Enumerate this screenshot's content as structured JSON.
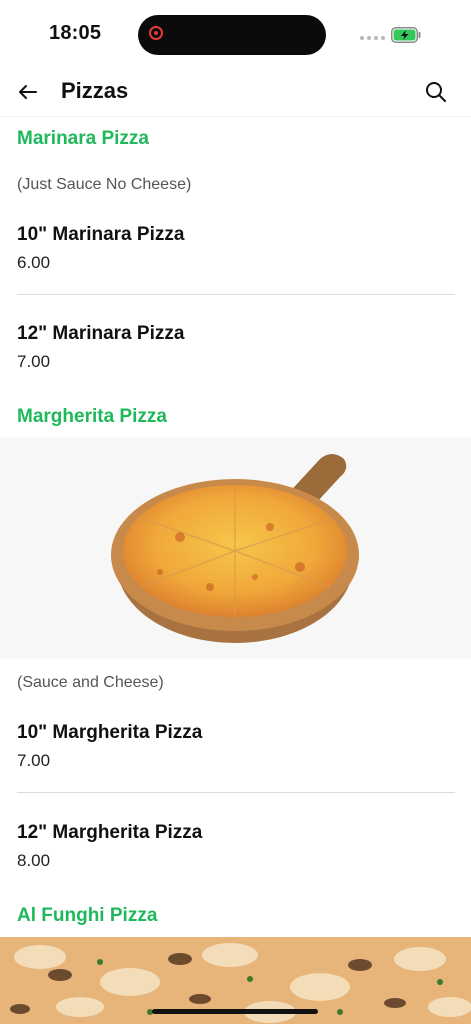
{
  "status": {
    "time": "18:05"
  },
  "header": {
    "title": "Pizzas"
  },
  "sections": [
    {
      "title": "Marinara Pizza",
      "description": "(Just Sauce No Cheese)",
      "items": [
        {
          "name": "10\" Marinara Pizza",
          "price": "6.00"
        },
        {
          "name": "12\" Marinara Pizza",
          "price": "7.00"
        }
      ]
    },
    {
      "title": "Margherita Pizza",
      "description": "(Sauce and Cheese)",
      "items": [
        {
          "name": "10\" Margherita Pizza",
          "price": "7.00"
        },
        {
          "name": "12\" Margherita Pizza",
          "price": "8.00"
        }
      ]
    },
    {
      "title": "Al Funghi Pizza"
    }
  ],
  "colors": {
    "accent": "#1fb85a",
    "battery": "#34c759"
  }
}
